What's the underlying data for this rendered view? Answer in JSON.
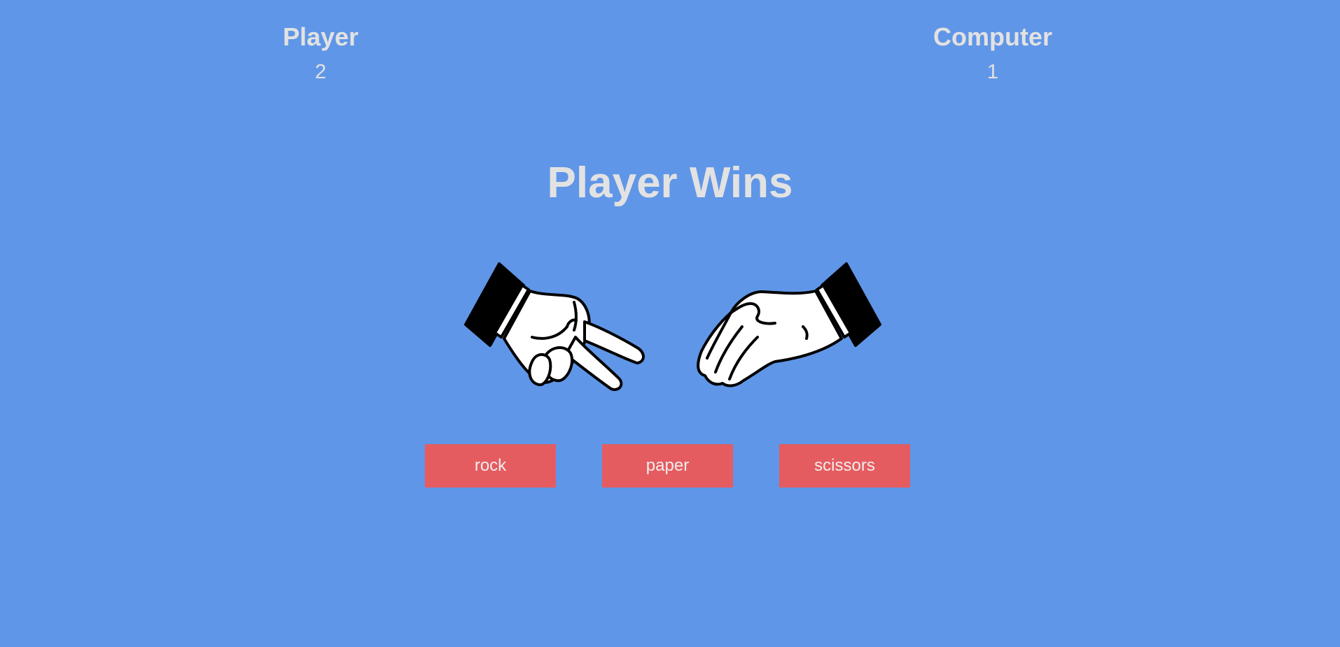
{
  "scoreboard": {
    "player": {
      "label": "Player",
      "score": "2"
    },
    "computer": {
      "label": "Computer",
      "score": "1"
    }
  },
  "result": "Player Wins",
  "hands": {
    "player": {
      "icon": "scissors-hand-icon"
    },
    "computer": {
      "icon": "paper-hand-icon"
    }
  },
  "choices": [
    {
      "label": "rock"
    },
    {
      "label": "paper"
    },
    {
      "label": "scissors"
    }
  ],
  "colors": {
    "background": "#6096e7",
    "button": "#e55c60",
    "text": "#e2e2e2"
  }
}
